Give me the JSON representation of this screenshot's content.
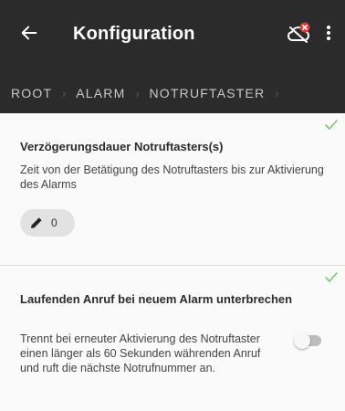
{
  "appbar": {
    "title": "Konfiguration",
    "back_icon": "arrow-left-icon",
    "cloud_icon": "cloud-offline-icon",
    "more_icon": "more-vertical-icon"
  },
  "breadcrumb": {
    "items": [
      "ROOT",
      "ALARM",
      "NOTRUFTASTER"
    ],
    "separator": "›"
  },
  "settings": [
    {
      "title": "Verzögerungsdauer Notruftasters(s)",
      "description": "Zeit von der Betätigung des Notruftasters bis zur Aktivierung des Alarms",
      "value": "0",
      "status": "saved",
      "edit_icon": "pencil-icon"
    },
    {
      "title": "Laufenden Anruf bei neuem Alarm unterbrechen",
      "description": "Trennt bei erneuter Aktivierung des Notruftaster einen länger als 60 Sekunden währenden Anruf und ruft die nächste Notrufnummer an.",
      "toggle_on": false,
      "status": "saved"
    }
  ],
  "colors": {
    "appbar": "#2b2b2b",
    "accent_check": "#7cc576",
    "cloud_alert": "#e53935"
  }
}
